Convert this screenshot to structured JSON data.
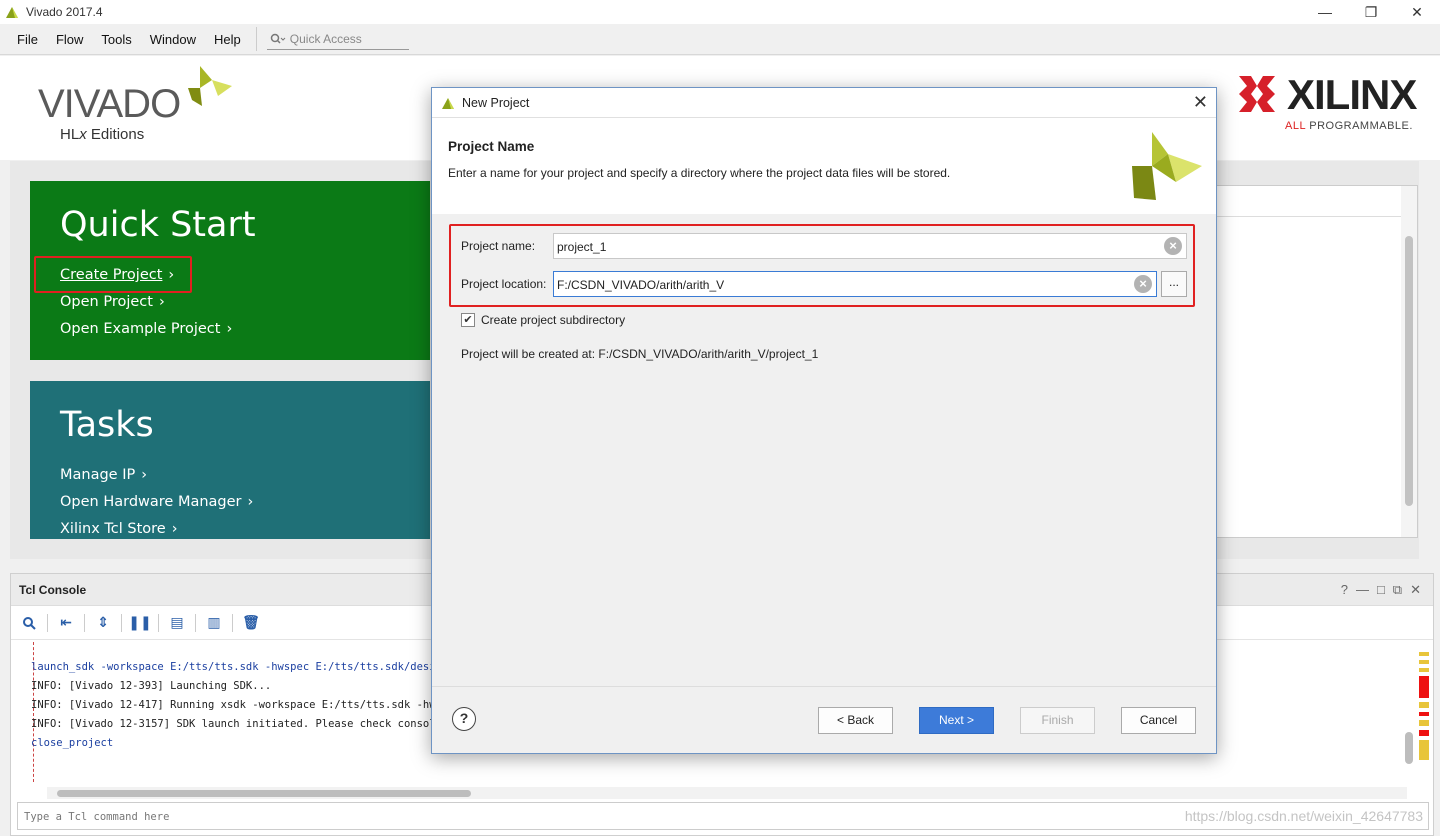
{
  "window": {
    "title": "Vivado 2017.4",
    "controls": [
      "—",
      "❐",
      "✕"
    ]
  },
  "menu": {
    "items": [
      "File",
      "Flow",
      "Tools",
      "Window",
      "Help"
    ],
    "quick_access_placeholder": "Quick Access"
  },
  "branding": {
    "vivado_name": "VIVADO",
    "vivado_sub_prefix": "HL",
    "vivado_sub_x": "x",
    "vivado_sub_suffix": " Editions",
    "xilinx_name": "XILINX",
    "xilinx_tag_all": "ALL",
    "xilinx_tag_rest": " PROGRAMMABLE."
  },
  "quick_start": {
    "title": "Quick Start",
    "links": [
      "Create Project",
      "Open Project",
      "Open Example Project"
    ]
  },
  "tasks": {
    "title": "Tasks",
    "links": [
      "Manage IP",
      "Open Hardware Manager",
      "Xilinx Tcl Store"
    ]
  },
  "tcl_console": {
    "title": "Tcl Console",
    "header_icons": [
      "?",
      "—",
      "□",
      "⧉",
      "✕"
    ],
    "lines": [
      {
        "kind": "cmd",
        "text": "launch_sdk -workspace E:/tts/tts.sdk -hwspec E:/tts/tts.sdk/desi"
      },
      {
        "kind": "info",
        "text": "INFO: [Vivado 12-393] Launching SDK..."
      },
      {
        "kind": "info",
        "text": "INFO: [Vivado 12-417] Running xsdk -workspace E:/tts/tts.sdk -hw"
      },
      {
        "kind": "info",
        "text": "INFO: [Vivado 12-3157] SDK launch initiated. Please check consol"
      },
      {
        "kind": "cmd",
        "text": "close_project"
      }
    ],
    "input_placeholder": "Type a Tcl command here",
    "watermark": "https://blog.csdn.net/weixin_42647783"
  },
  "dialog": {
    "title": "New Project",
    "close": "✕",
    "heading": "Project Name",
    "description": "Enter a name for your project and specify a directory where the project data files will be stored.",
    "project_name_label": "Project name:",
    "project_name_value": "project_1",
    "project_location_label": "Project location:",
    "project_location_value": "F:/CSDN_VIVADO/arith/arith_V",
    "browse_label": "...",
    "checkbox_label": "Create project subdirectory",
    "checkbox_checked": true,
    "created_at_prefix": "Project will be created at: ",
    "created_at_path": "F:/CSDN_VIVADO/arith/arith_V/project_1",
    "help": "?",
    "buttons": {
      "back": "< Back",
      "next": "Next >",
      "finish": "Finish",
      "cancel": "Cancel"
    }
  },
  "colors": {
    "quick_start_bg": "#0b7a16",
    "tasks_bg": "#1f7077",
    "highlight_red": "#e02020",
    "primary_button": "#3d7bd9"
  }
}
